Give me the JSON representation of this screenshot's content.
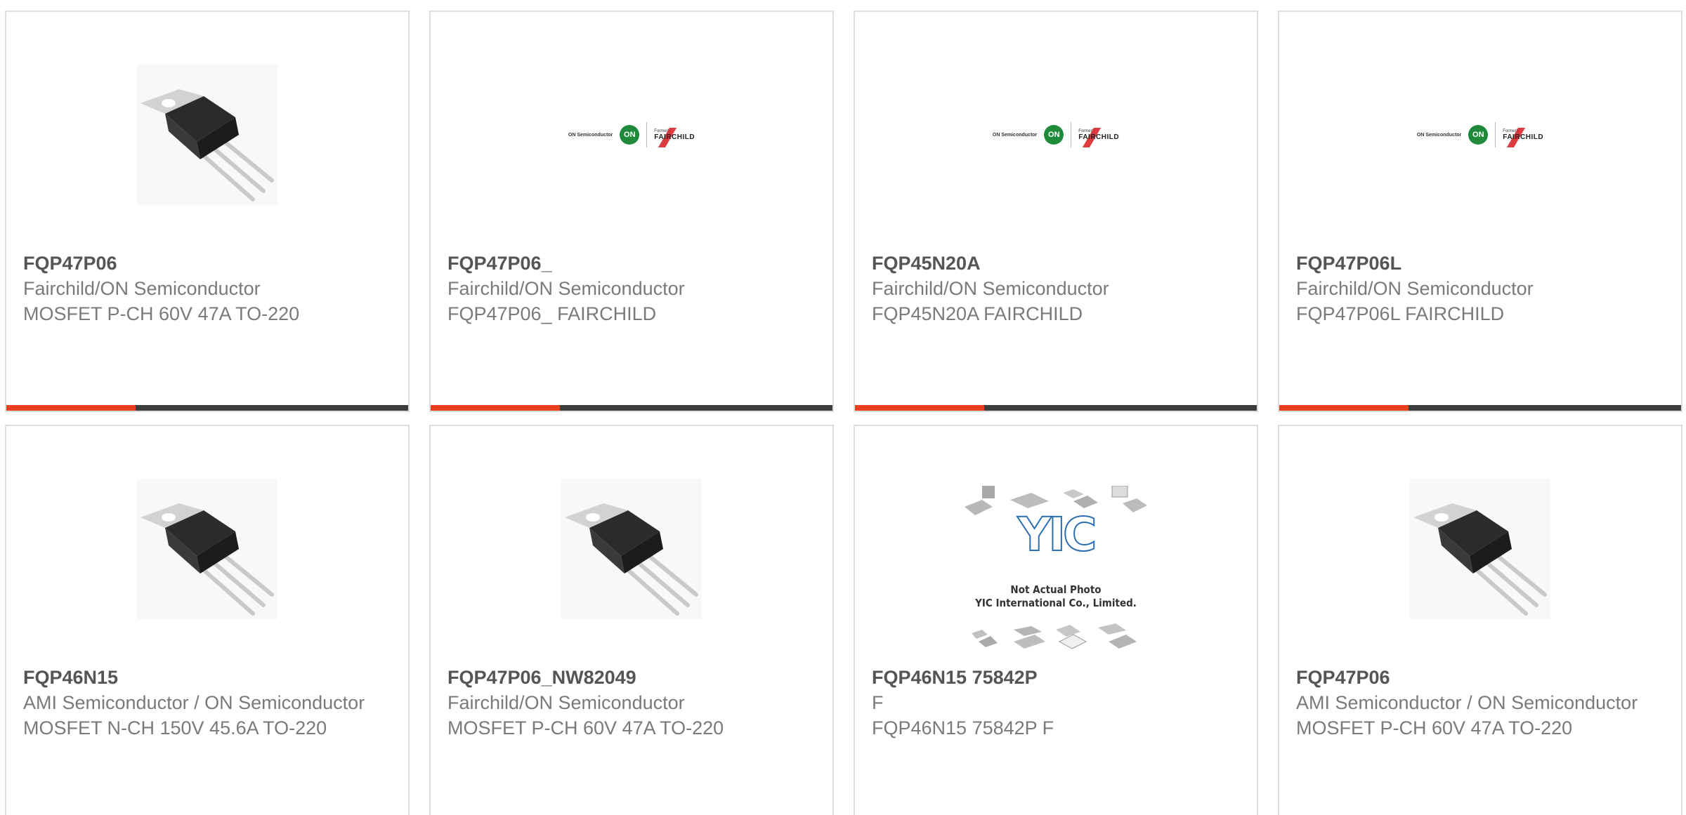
{
  "colors": {
    "accent": "#e8401c",
    "bar": "#3d3d3d",
    "on_green": "#1f8a3a",
    "fairchild_red": "#d9262b"
  },
  "logo": {
    "on_text": "ON Semiconductor",
    "on_mark": "ON",
    "formerly": "Formerly",
    "fairchild": "FAIRCHILD"
  },
  "yic": {
    "mark": "YIC",
    "caption_line1": "Not Actual Photo",
    "caption_line2": "YIC International Co., Limited."
  },
  "products": [
    {
      "part_number": "FQP47P06",
      "manufacturer": "Fairchild/ON Semiconductor",
      "description": "MOSFET P-CH 60V 47A TO-220",
      "image": "to220-transistor"
    },
    {
      "part_number": "FQP47P06_",
      "manufacturer": "Fairchild/ON Semiconductor",
      "description": "FQP47P06_ FAIRCHILD",
      "image": "on-fairchild-logo"
    },
    {
      "part_number": "FQP45N20A",
      "manufacturer": "Fairchild/ON Semiconductor",
      "description": "FQP45N20A FAIRCHILD",
      "image": "on-fairchild-logo"
    },
    {
      "part_number": "FQP47P06L",
      "manufacturer": "Fairchild/ON Semiconductor",
      "description": "FQP47P06L FAIRCHILD",
      "image": "on-fairchild-logo"
    },
    {
      "part_number": "FQP46N15",
      "manufacturer": "AMI Semiconductor / ON Semiconductor",
      "description": "MOSFET N-CH 150V 45.6A TO-220",
      "image": "to220-transistor"
    },
    {
      "part_number": "FQP47P06_NW82049",
      "manufacturer": "Fairchild/ON Semiconductor",
      "description": "MOSFET P-CH 60V 47A TO-220",
      "image": "to220-transistor"
    },
    {
      "part_number": "FQP46N15 75842P",
      "manufacturer": "F",
      "description": "FQP46N15 75842P F",
      "image": "yic-placeholder"
    },
    {
      "part_number": "FQP47P06",
      "manufacturer": "AMI Semiconductor / ON Semiconductor",
      "description": "MOSFET P-CH 60V 47A TO-220",
      "image": "to220-transistor"
    }
  ]
}
